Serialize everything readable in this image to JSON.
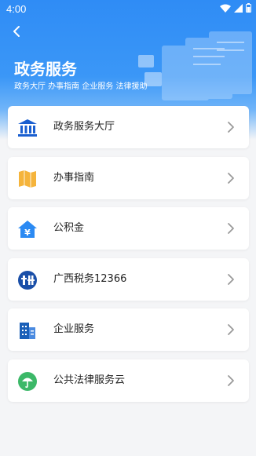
{
  "status_bar": {
    "time": "4:00",
    "icons": [
      "wifi-icon",
      "signal-icon",
      "battery-icon"
    ]
  },
  "header": {
    "back_icon": "chevron-left-icon",
    "title": "政务服务",
    "subtitle": "政务大厅 办事指南 企业服务 法律援助"
  },
  "services": [
    {
      "label": "政务服务大厅",
      "icon": "government-hall-icon",
      "color": "#1a5fd0"
    },
    {
      "label": "办事指南",
      "icon": "guide-map-icon",
      "color": "#f5b43c"
    },
    {
      "label": "公积金",
      "icon": "house-fund-icon",
      "color": "#2b8af3"
    },
    {
      "label": "广西税务12366",
      "icon": "tax-seal-icon",
      "color": "#1a4fa8"
    },
    {
      "label": "企业服务",
      "icon": "building-icon",
      "color": "#1a5fb8"
    },
    {
      "label": "公共法律服务云",
      "icon": "umbrella-icon",
      "color": "#3cb868"
    }
  ],
  "colors": {
    "header_blue": "#2f8cf5",
    "background": "#f4f5f7",
    "chevron": "#9a9a9a"
  }
}
